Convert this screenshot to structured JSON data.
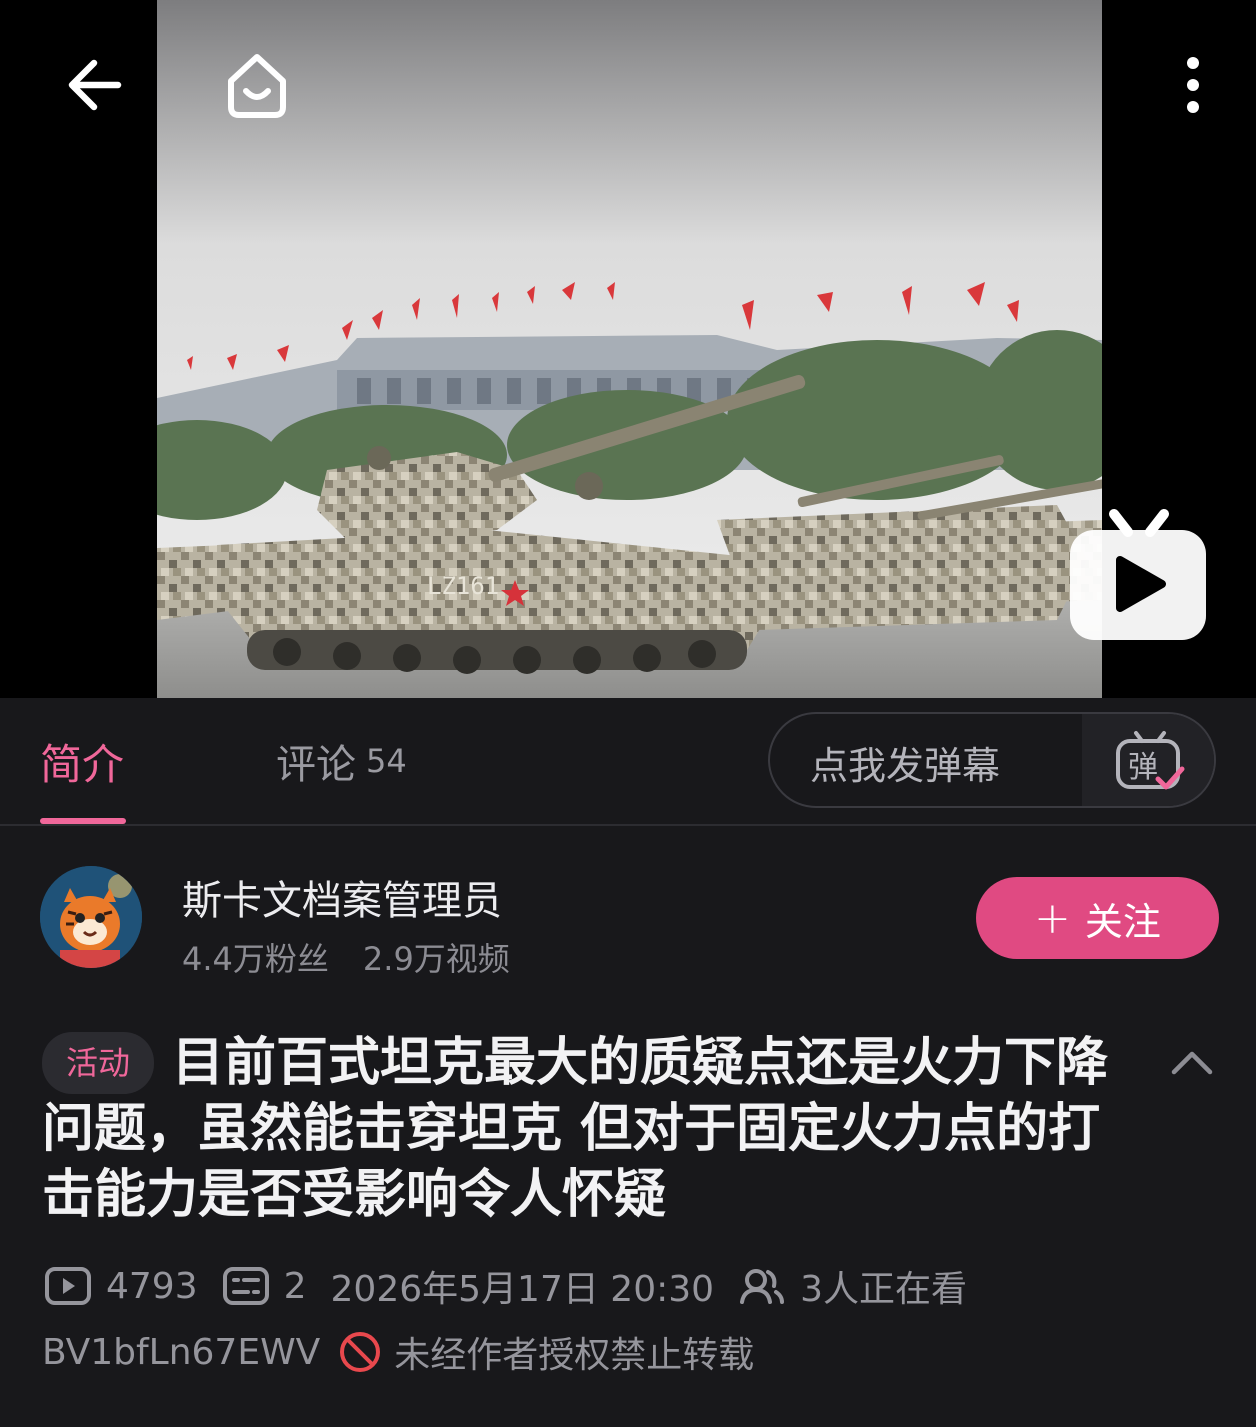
{
  "video": {
    "tank_marking": "LZ161"
  },
  "icons": {
    "back": "arrow-left-icon",
    "home": "home-icon",
    "more": "more-vertical-icon",
    "play": "tv-play-icon",
    "danmaku": "danmaku-toggle-icon",
    "collapse": "chevron-up-icon",
    "views": "play-count-icon",
    "danmaku_count": "danmaku-count-icon",
    "viewers": "viewers-icon",
    "forbid": "no-repost-icon"
  },
  "tabs": {
    "intro_label": "简介",
    "comments_label": "评论",
    "comments_count": "54"
  },
  "danmaku": {
    "placeholder": "点我发弹幕",
    "toggle_char": "弹"
  },
  "uploader": {
    "name": "斯卡文档案管理员",
    "followers": "4.4万粉丝",
    "videos": "2.9万视频",
    "follow_label": "关注",
    "follow_plus": "+"
  },
  "title": {
    "badge": "活动",
    "text": "目前百式坦克最大的质疑点还是火力下降问题，虽然能击穿坦克 但对于固定火力点的打击能力是否受影响令人怀疑"
  },
  "meta": {
    "views": "4793",
    "danmaku_count": "2",
    "datetime": "2026年5月17日 20:30",
    "watching": "3人正在看",
    "bvid": "BV1bfLn67EWV",
    "copyright_notice": "未经作者授权禁止转载"
  },
  "colors": {
    "accent_pink": "#f0679a",
    "follow_button": "#e04a82",
    "background": "#18181b",
    "muted_text": "#95959c"
  }
}
